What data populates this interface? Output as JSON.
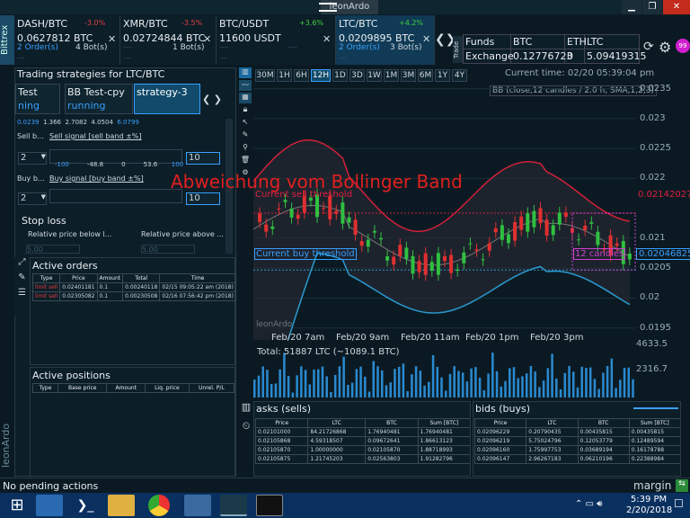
{
  "window": {
    "title": "leonArdo",
    "min": "▁",
    "max": "❐",
    "close": "✕"
  },
  "exchange": "Bittrex",
  "tickers": [
    {
      "pair": "DASH/BTC",
      "change": "-3.0%",
      "price": "0.0627812 BTC",
      "orders": "2 Order(s)",
      "bots": "4 Bot(s)",
      "dash": "---"
    },
    {
      "pair": "XMR/BTC",
      "change": "-3.5%",
      "price": "0.02724844 BTC",
      "orders": "---",
      "bots": "1 Bot(s)",
      "dash": "---"
    },
    {
      "pair": "BTC/USDT",
      "change": "+3.6%",
      "price": "11600 USDT",
      "orders": "---",
      "bots": "---",
      "dash": "---"
    },
    {
      "pair": "LTC/BTC",
      "change": "+4.2%",
      "price": "0.0209895 BTC",
      "orders": "2 Order(s)",
      "bots": "3 Bot(s)",
      "dash": "---"
    }
  ],
  "trade_label": "Trade",
  "funds": {
    "h1": "Funds",
    "h2": "BTC",
    "h3": "ETH",
    "h4": "LTC",
    "r1": "Exchange",
    "r2": "0.12776723",
    "r3": "0",
    "r4": "5.09419315"
  },
  "strategies": {
    "title": "Trading strategies for LTC/BTC",
    "tabs": [
      {
        "name": "Test",
        "status": "ning"
      },
      {
        "name": "BB Test-cpy",
        "status": "running"
      },
      {
        "name": "strategy-3",
        "status": ""
      }
    ],
    "nums": [
      "0.0239",
      "1.366",
      "2.7082",
      "4.0504",
      "6.0799"
    ],
    "sell_label": "Sell b...",
    "sell_signal": "Sell signal [sell band ±%]",
    "sell_count": "2",
    "sell_val": "10",
    "buy_label": "Buy b...",
    "buy_signal": "Buy signal [buy band ±%]",
    "buy_count": "2",
    "buy_val": "10",
    "slider_ticks": [
      "-100",
      "-48.8",
      "0",
      "53.6",
      "100"
    ],
    "stop_loss": "Stop loss",
    "rel_below": "Relative price below l...",
    "rel_above": "Relative price above ...",
    "stop_val": "5.00"
  },
  "orders": {
    "title": "Active orders",
    "cols": [
      "Type",
      "Price",
      "Amount",
      "Total",
      "Time"
    ],
    "rows": [
      [
        "limit sell",
        "0.02401181",
        "0.1",
        "0.00240118",
        "02/15 09:05:22 am (2018)"
      ],
      [
        "limit sell",
        "0.02305082",
        "0.1",
        "0.00230508",
        "02/16 07:56:42 pm (2018)"
      ]
    ]
  },
  "positions": {
    "title": "Active positions",
    "cols": [
      "Type",
      "Base price",
      "Amount",
      "Liq. price",
      "Unrel. P/L"
    ]
  },
  "chart": {
    "timeframes": [
      "30M",
      "1H",
      "6H",
      "12H",
      "1D",
      "3D",
      "1W",
      "1M",
      "3M",
      "6M",
      "1Y",
      "4Y"
    ],
    "selected": "12H",
    "current_time": "Current time: 02/20 05:39:04 pm",
    "indicator": "BB (close,12 candles / 2.0 h, SMA,1,2,3)",
    "overlay_text": "Abweichung vom Bollinger Band",
    "sell_threshold": "Current sell threshold",
    "buy_threshold": "Current buy threshold",
    "candles_label": "12 candles",
    "watermark": "leonArdo",
    "price_ticks": [
      "0.0235",
      "0.023",
      "0.0225",
      "0.022",
      "0.021",
      "0.0205",
      "0.02",
      "0.0195"
    ],
    "sell_price": "0.02142027",
    "buy_price": "0.02046825",
    "time_ticks": [
      "Feb/20 7am",
      "Feb/20 9am",
      "Feb/20 11am",
      "Feb/20 1pm",
      "Feb/20 3pm"
    ],
    "volume_total": "Total: 51887 LTC (~1089.1 BTC)",
    "vol_ticks": [
      "4633.5",
      "2316.7"
    ]
  },
  "chart_data": {
    "type": "candlestick",
    "x": [
      "Feb/20 7am",
      "Feb/20 9am",
      "Feb/20 11am",
      "Feb/20 1pm",
      "Feb/20 3pm"
    ],
    "ylim": [
      0.0193,
      0.0236
    ],
    "sell_threshold": 0.02142027,
    "buy_threshold": 0.02046825
  },
  "asks": {
    "title": "asks (sells)",
    "cols": [
      "Price",
      "LTC",
      "BTC",
      "Sum [BTC]"
    ],
    "rows": [
      [
        "0.02101000",
        "84.21726868",
        "1.76940481",
        "1.76940481"
      ],
      [
        "0.02105868",
        "4.59318507",
        "0.09672641",
        "1.86613123"
      ],
      [
        "0.02105870",
        "1.00000000",
        "0.02105870",
        "1.88718993"
      ],
      [
        "0.02105875",
        "1.21745203",
        "0.02563803",
        "1.91282796"
      ]
    ]
  },
  "bids": {
    "title": "bids (buys)",
    "cols": [
      "Price",
      "LTC",
      "BTC",
      "Sum [BTC]"
    ],
    "rows": [
      [
        "0.02096229",
        "0.20790435",
        "0.00435815",
        "0.00435815"
      ],
      [
        "0.02096219",
        "5.75024796",
        "0.12053779",
        "0.12489594"
      ],
      [
        "0.02096160",
        "1.75997753",
        "0.03689194",
        "0.16178788"
      ],
      [
        "0.02096147",
        "2.96267183",
        "0.06210196",
        "0.22388984"
      ]
    ]
  },
  "status": "No pending actions",
  "brand": "margin",
  "clock": {
    "time": "5:39 PM",
    "date": "2/20/2018"
  }
}
